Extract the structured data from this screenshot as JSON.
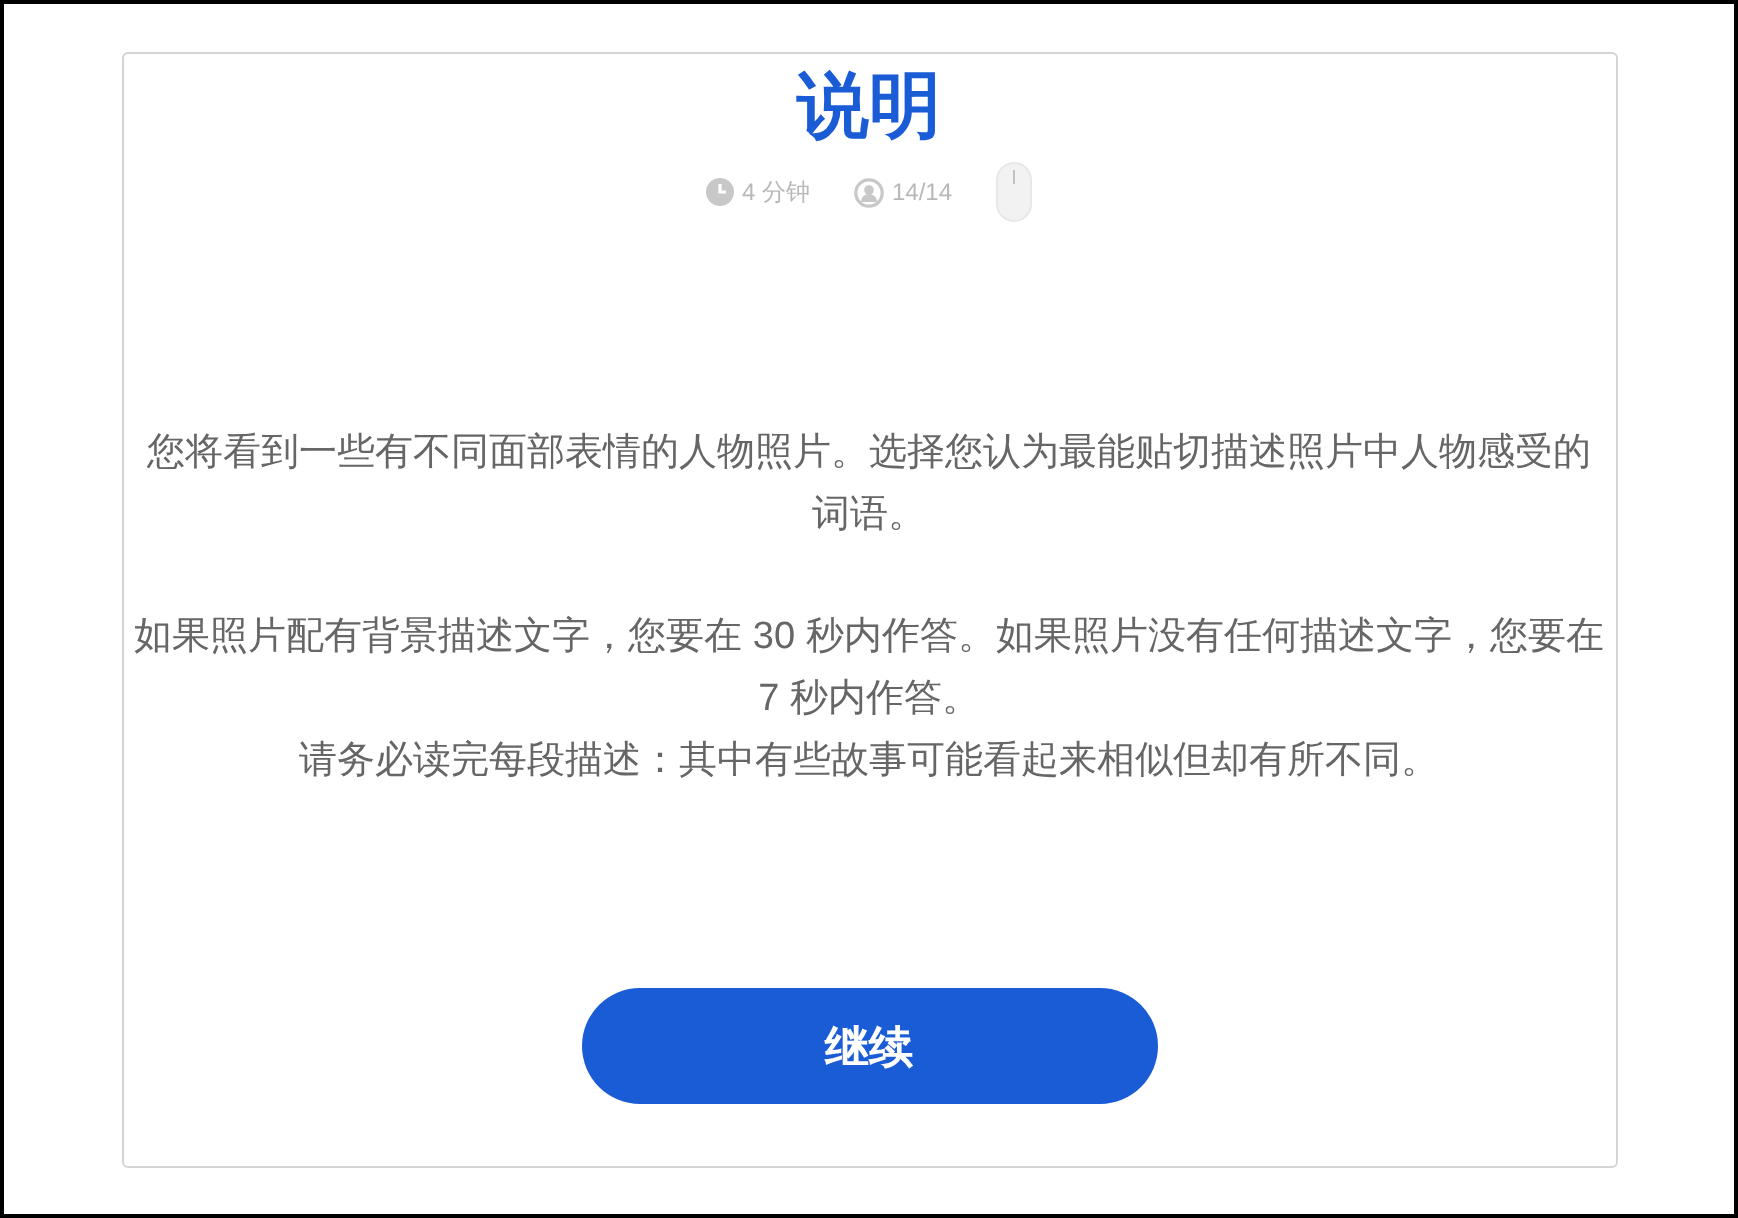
{
  "title": "说明",
  "meta": {
    "duration": "4 分钟",
    "progress": "14/14"
  },
  "sections": [
    [
      "您将看到一些有不同面部表情的人物照片。选择您认为最能贴切描述照片中人物感受的词语。"
    ],
    [
      "如果照片配有背景描述文字，您要在 30 秒内作答。如果照片没有任何描述文字，您要在 7 秒内作答。",
      "请务必读完每段描述：其中有些故事可能看起来相似但却有所不同。"
    ]
  ],
  "button": "继续"
}
